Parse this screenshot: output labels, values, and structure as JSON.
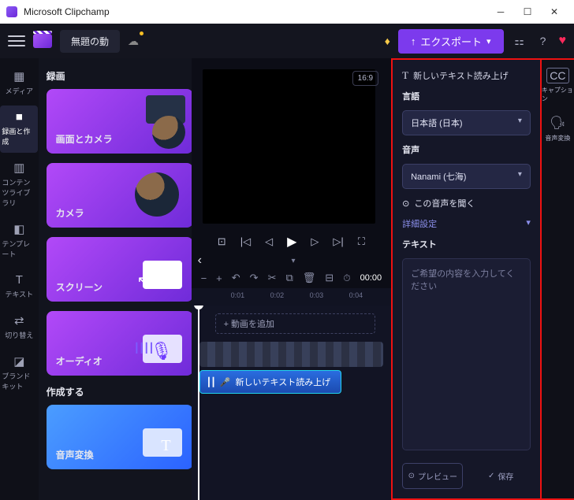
{
  "titlebar": {
    "app_name": "Microsoft Clipchamp"
  },
  "topbar": {
    "project_title": "無題の動",
    "export_label": "エクスポート"
  },
  "rail": {
    "items": [
      {
        "icon": "▦",
        "label": "メディア"
      },
      {
        "icon": "■",
        "label": "録画と作成"
      },
      {
        "icon": "▥",
        "label": "コンテンツライブラリ"
      },
      {
        "icon": "◧",
        "label": "テンプレート"
      },
      {
        "icon": "T",
        "label": "テキスト"
      },
      {
        "icon": "⇄",
        "label": "切り替え"
      },
      {
        "icon": "◪",
        "label": "ブランドキット"
      }
    ]
  },
  "leftpanel": {
    "section_record": "録画",
    "cards": {
      "screen_camera": "画面とカメラ",
      "camera": "カメラ",
      "screen": "スクリーン",
      "audio": "オーディオ"
    },
    "section_create": "作成する",
    "create_tts": "音声変換"
  },
  "center": {
    "ratio": "16:9",
    "timecode": "00:00",
    "add_video": "+  動画を追加",
    "tts_clip_label": "新しいテキスト読み上げ",
    "ruler": [
      "0:01",
      "0:02",
      "0:03",
      "0:04"
    ]
  },
  "tts": {
    "header": "新しいテキスト読み上げ",
    "lang_label": "言語",
    "lang_value": "日本語 (日本)",
    "voice_label": "音声",
    "voice_value": "Nanami (七海)",
    "listen": "この音声を聞く",
    "advanced": "詳細設定",
    "text_label": "テキスト",
    "placeholder": "ご希望の内容を入力してください",
    "preview_btn": "プレビュー",
    "save_btn": "保存"
  },
  "rightrail": {
    "caption": "キャプション",
    "tts": "音声変換"
  }
}
